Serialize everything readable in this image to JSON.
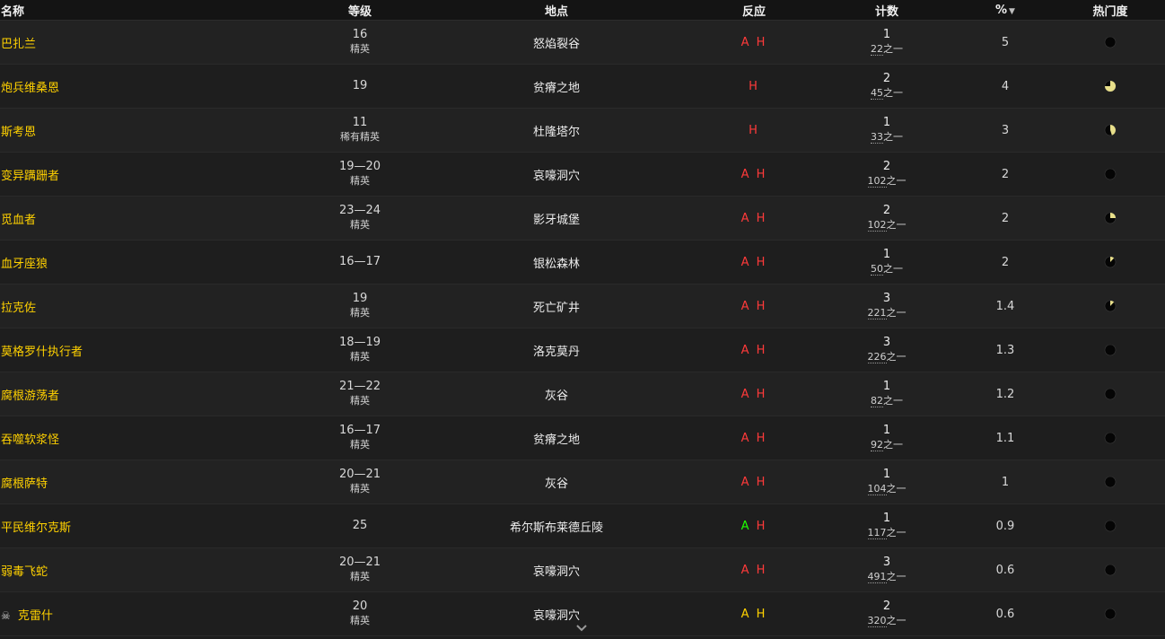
{
  "table": {
    "headers": {
      "name": "名称",
      "level": "等级",
      "location": "地点",
      "reaction": "反应",
      "count": "计数",
      "percent": "%",
      "popularity": "热门度"
    },
    "sort_arrow": "▼",
    "of_suffix": "之一",
    "rows": [
      {
        "name": "巴扎兰",
        "level": "16",
        "type": "精英",
        "location": "怒焰裂谷",
        "reaction": [
          {
            "t": "A",
            "c": "red"
          },
          {
            "t": "H",
            "c": "red"
          }
        ],
        "count": "1",
        "total": "22",
        "percent": "5",
        "pie": 0.0,
        "skull": false
      },
      {
        "name": "炮兵维桑恩",
        "level": "19",
        "type": "",
        "location": "贫瘠之地",
        "reaction": [
          {
            "t": "H",
            "c": "red"
          }
        ],
        "count": "2",
        "total": "45",
        "percent": "4",
        "pie": 0.75,
        "skull": false
      },
      {
        "name": "斯考恩",
        "level": "11",
        "type": "稀有精英",
        "location": "杜隆塔尔",
        "reaction": [
          {
            "t": "H",
            "c": "red"
          }
        ],
        "count": "1",
        "total": "33",
        "percent": "3",
        "pie": 0.45,
        "skull": false
      },
      {
        "name": "变异蹒跚者",
        "level": "19—20",
        "type": "精英",
        "location": "哀嚎洞穴",
        "reaction": [
          {
            "t": "A",
            "c": "red"
          },
          {
            "t": "H",
            "c": "red"
          }
        ],
        "count": "2",
        "total": "102",
        "percent": "2",
        "pie": 0.0,
        "skull": false
      },
      {
        "name": "觅血者",
        "level": "23—24",
        "type": "精英",
        "location": "影牙城堡",
        "reaction": [
          {
            "t": "A",
            "c": "red"
          },
          {
            "t": "H",
            "c": "red"
          }
        ],
        "count": "2",
        "total": "102",
        "percent": "2",
        "pie": 0.25,
        "skull": false
      },
      {
        "name": "血牙座狼",
        "level": "16—17",
        "type": "",
        "location": "银松森林",
        "reaction": [
          {
            "t": "A",
            "c": "red"
          },
          {
            "t": "H",
            "c": "red"
          }
        ],
        "count": "1",
        "total": "50",
        "percent": "2",
        "pie": 0.12,
        "skull": false
      },
      {
        "name": "拉克佐",
        "level": "19",
        "type": "精英",
        "location": "死亡矿井",
        "reaction": [
          {
            "t": "A",
            "c": "red"
          },
          {
            "t": "H",
            "c": "red"
          }
        ],
        "count": "3",
        "total": "221",
        "percent": "1.4",
        "pie": 0.12,
        "skull": false
      },
      {
        "name": "莫格罗什执行者",
        "level": "18—19",
        "type": "精英",
        "location": "洛克莫丹",
        "reaction": [
          {
            "t": "A",
            "c": "red"
          },
          {
            "t": "H",
            "c": "red"
          }
        ],
        "count": "3",
        "total": "226",
        "percent": "1.3",
        "pie": 0.0,
        "skull": false
      },
      {
        "name": "腐根游荡者",
        "level": "21—22",
        "type": "精英",
        "location": "灰谷",
        "reaction": [
          {
            "t": "A",
            "c": "red"
          },
          {
            "t": "H",
            "c": "red"
          }
        ],
        "count": "1",
        "total": "82",
        "percent": "1.2",
        "pie": 0.0,
        "skull": false
      },
      {
        "name": "吞噬软浆怪",
        "level": "16—17",
        "type": "精英",
        "location": "贫瘠之地",
        "reaction": [
          {
            "t": "A",
            "c": "red"
          },
          {
            "t": "H",
            "c": "red"
          }
        ],
        "count": "1",
        "total": "92",
        "percent": "1.1",
        "pie": 0.0,
        "skull": false
      },
      {
        "name": "腐根萨特",
        "level": "20—21",
        "type": "精英",
        "location": "灰谷",
        "reaction": [
          {
            "t": "A",
            "c": "red"
          },
          {
            "t": "H",
            "c": "red"
          }
        ],
        "count": "1",
        "total": "104",
        "percent": "1",
        "pie": 0.0,
        "skull": false
      },
      {
        "name": "平民维尔克斯",
        "level": "25",
        "type": "",
        "location": "希尔斯布莱德丘陵",
        "reaction": [
          {
            "t": "A",
            "c": "green"
          },
          {
            "t": "H",
            "c": "red"
          }
        ],
        "count": "1",
        "total": "117",
        "percent": "0.9",
        "pie": 0.0,
        "skull": false
      },
      {
        "name": "弱毒飞蛇",
        "level": "20—21",
        "type": "精英",
        "location": "哀嚎洞穴",
        "reaction": [
          {
            "t": "A",
            "c": "red"
          },
          {
            "t": "H",
            "c": "red"
          }
        ],
        "count": "3",
        "total": "491",
        "percent": "0.6",
        "pie": 0.0,
        "skull": false
      },
      {
        "name": "克雷什",
        "level": "20",
        "type": "精英",
        "location": "哀嚎洞穴",
        "reaction": [
          {
            "t": "A",
            "c": "yellow"
          },
          {
            "t": "H",
            "c": "yellow"
          }
        ],
        "count": "2",
        "total": "320",
        "percent": "0.6",
        "pie": 0.0,
        "skull": true
      }
    ]
  },
  "colors": {
    "name_link": "#ffd100",
    "reaction_red": "#ff3a3a",
    "reaction_green": "#1eff00",
    "reaction_yellow": "#ffd100",
    "pie_fill": "#e8df8a"
  }
}
